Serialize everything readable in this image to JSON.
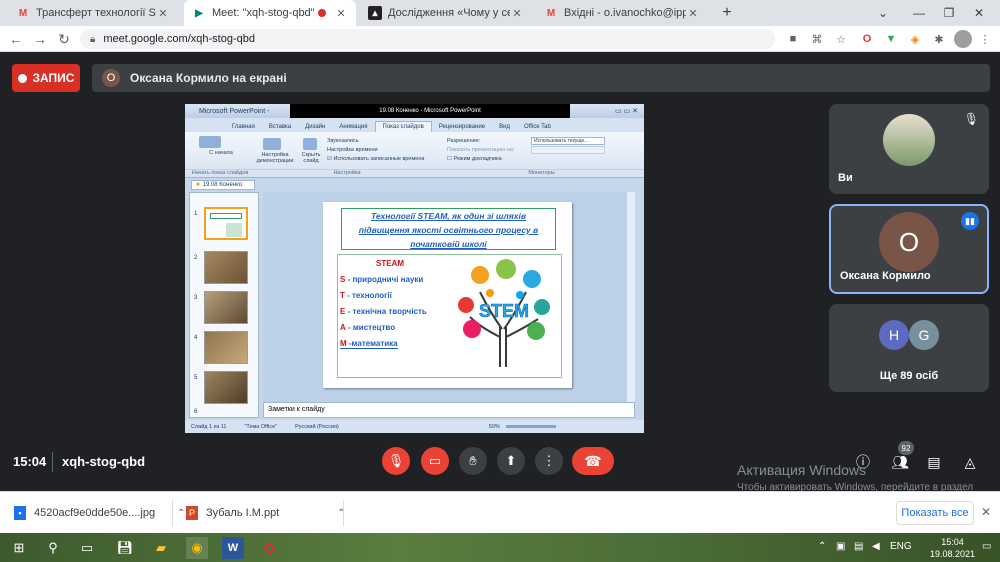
{
  "browser": {
    "tabs": [
      {
        "title": "Трансферт технології STEAM, як",
        "favicon": "gmail-icon"
      },
      {
        "title": "Meet: \"xqh-stog-qbd\"",
        "favicon": "meet-icon",
        "recording": true
      },
      {
        "title": "Дослідження «Чому у серпні тр",
        "favicon": "survey-icon"
      },
      {
        "title": "Вхідні - o.ivanochko@ippo.edu.",
        "favicon": "gmail-icon"
      }
    ],
    "new_tab": "+",
    "url": "meet.google.com/xqh-stog-qbd"
  },
  "meet": {
    "record_label": "ЗАПИС",
    "presenter_initial": "О",
    "presenter_text": "Оксана Кормило на екрані",
    "tiles": [
      {
        "name": "Ви"
      },
      {
        "name": "Оксана Кормило",
        "initial": "О"
      },
      {
        "name": "Ще 89 осіб",
        "initials": [
          "H",
          "G"
        ]
      }
    ],
    "time": "15:04",
    "meeting_code": "xqh-stog-qbd",
    "participants_badge": "92"
  },
  "powerpoint": {
    "window_title": "Microsoft PowerPoint -",
    "black_title": "19.08 Коненко - Microsoft PowerPoint",
    "ribbon_tabs": [
      "Главная",
      "Вставка",
      "Дизайн",
      "Анимация",
      "Показ слайдов",
      "Рецензирование",
      "Вид",
      "Office Tab"
    ],
    "active_tab": "Показ слайдов",
    "ribbon": {
      "from_start": "С начала",
      "setup": "Настройка демонстрации",
      "hide": "Скрыть слайд",
      "sound": "Звукозапись",
      "timing": "Настройка времени",
      "use_timing": "Использовать записанные времена",
      "resolution": "Разрешение:",
      "resolution_val": "Использовать текуще...",
      "show_on": "Показать презентацию на:",
      "presenter_mode": "Режим докладчика",
      "grp1": "Начать показ слайдов",
      "grp2": "Настройка",
      "grp3": "Мониторы"
    },
    "doc_tab": "19.08 Коненко",
    "slide_numbers": [
      "1",
      "2",
      "3",
      "4",
      "5",
      "6"
    ],
    "slide": {
      "title_lines": [
        "Технології STEAM, як один зі шляхів",
        "підвищення якості освітнього процесу в",
        "початковій школі"
      ],
      "steam_heading": "STEAM",
      "items": [
        {
          "letter": "S",
          "text": " - природничі науки"
        },
        {
          "letter": "T",
          "text": " - технології"
        },
        {
          "letter": "E",
          "text": " - технічна творчість"
        },
        {
          "letter": "A",
          "text": " - мистецтво"
        },
        {
          "letter": "M",
          "text": " -математика"
        }
      ],
      "graphic_word": "STEM"
    },
    "notes": "Заметки к слайду",
    "status": {
      "slide": "Слайд 1 из 11",
      "theme": "\"Тема Office\"",
      "lang": "Русский (Россия)",
      "zoom": "50%"
    }
  },
  "windows_activation": {
    "title": "Активация Windows",
    "text": "Чтобы активировать Windows, перейдите в раздел \"Параметры\"."
  },
  "downloads": [
    {
      "name": "4520acf9e0dde50e....jpg"
    },
    {
      "name": "Зубаль І.М.ppt"
    }
  ],
  "show_all": "Показать все",
  "taskbar": {
    "lang": "ENG",
    "time": "15:04",
    "date": "19.08.2021"
  }
}
